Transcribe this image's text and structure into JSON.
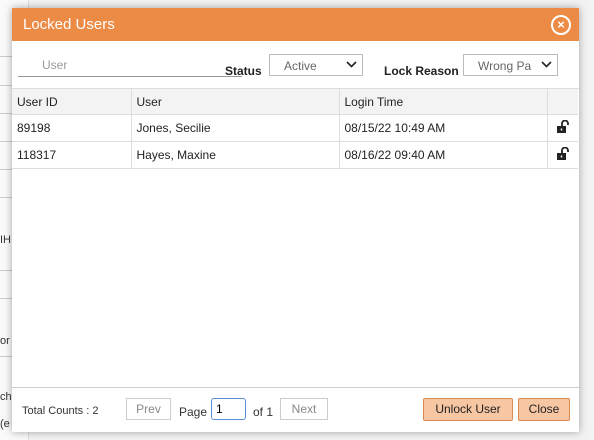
{
  "modal": {
    "title": "Locked Users"
  },
  "filters": {
    "user_placeholder": "User",
    "status_label": "Status",
    "status_value": "Active",
    "lock_reason_label": "Lock Reason",
    "lock_reason_value": "Wrong Pa"
  },
  "table": {
    "columns": [
      "User ID",
      "User",
      "Login Time",
      ""
    ],
    "rows": [
      {
        "user_id": "89198",
        "user": "Jones, Secilie",
        "login_time": "08/15/22 10:49 AM",
        "action_icon": "unlock-icon"
      },
      {
        "user_id": "118317",
        "user": "Hayes, Maxine",
        "login_time": "08/16/22 09:40 AM",
        "action_icon": "unlock-icon"
      }
    ]
  },
  "footer": {
    "total_counts": "Total Counts : 2",
    "prev_label": "Prev",
    "page_label": "Page",
    "page_value": "1",
    "of_label": "of 1",
    "next_label": "Next",
    "unlock_user_label": "Unlock User",
    "close_label": "Close"
  },
  "background": {
    "fragments": [
      "IH",
      "or",
      "ch",
      "e)"
    ]
  },
  "colors": {
    "header": "#ec8b45",
    "action_button": "#f7c6a3",
    "action_border": "#d98a52"
  }
}
